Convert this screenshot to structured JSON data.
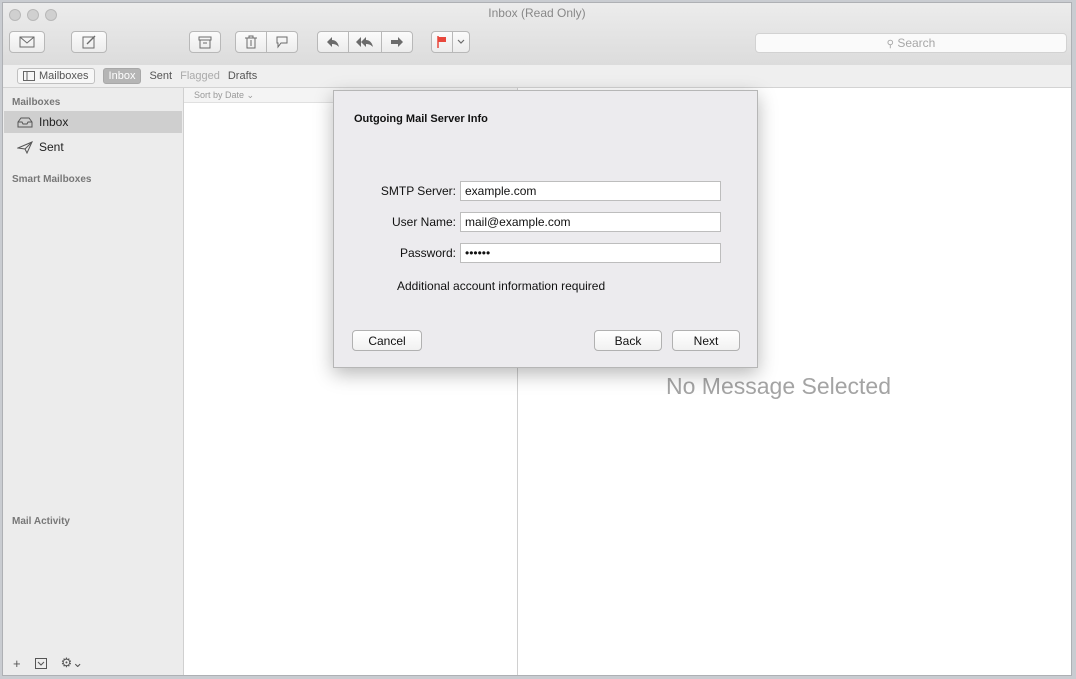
{
  "window": {
    "title": "Inbox (Read Only)"
  },
  "toolbar": {
    "search_placeholder": "Search",
    "icons": [
      "compose-envelope-icon",
      "new-note-icon",
      "archive-icon",
      "trash-icon",
      "junk-icon",
      "reply-icon",
      "reply-all-icon",
      "forward-icon",
      "flag-icon",
      "chevron-down-icon"
    ]
  },
  "favorites_bar": {
    "mailboxes": "Mailboxes",
    "inbox": "Inbox",
    "sent": "Sent",
    "flagged": "Flagged",
    "drafts": "Drafts"
  },
  "sidebar": {
    "mailboxes_header": "Mailboxes",
    "items": [
      {
        "label": "Inbox",
        "icon": "inbox-tray-icon",
        "selected": true
      },
      {
        "label": "Sent",
        "icon": "paper-plane-icon",
        "selected": false
      }
    ],
    "smart_header": "Smart Mailboxes",
    "activity_header": "Mail Activity",
    "footer_icons": [
      "plus-icon",
      "mailbox-icon",
      "gear-icon"
    ]
  },
  "message_list": {
    "sort_label": "Sort by Date ⌄"
  },
  "viewer": {
    "empty_text": "No Message Selected"
  },
  "dialog": {
    "title": "Outgoing Mail Server Info",
    "smtp_label": "SMTP Server:",
    "smtp_value": "example.com",
    "user_label": "User Name:",
    "user_value": "mail@example.com",
    "password_label": "Password:",
    "password_value": "••••••",
    "note": "Additional account information required",
    "cancel": "Cancel",
    "back": "Back",
    "next": "Next"
  },
  "colors": {
    "flag": "#e8473c",
    "selection": "#cfcfcf"
  }
}
